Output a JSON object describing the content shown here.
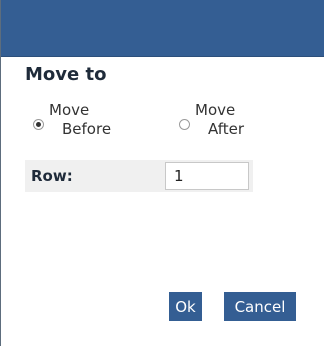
{
  "dialog": {
    "heading": "Move to",
    "options": [
      {
        "line1": "Move",
        "line2": "Before",
        "checked": true
      },
      {
        "line1": "Move",
        "line2": "After",
        "checked": false
      }
    ],
    "row": {
      "label": "Row:",
      "value": "1"
    },
    "buttons": {
      "ok": "Ok",
      "cancel": "Cancel"
    }
  },
  "colors": {
    "titlebar": "#345e93",
    "button": "#345e93",
    "field_bg": "#f0f0f0"
  }
}
